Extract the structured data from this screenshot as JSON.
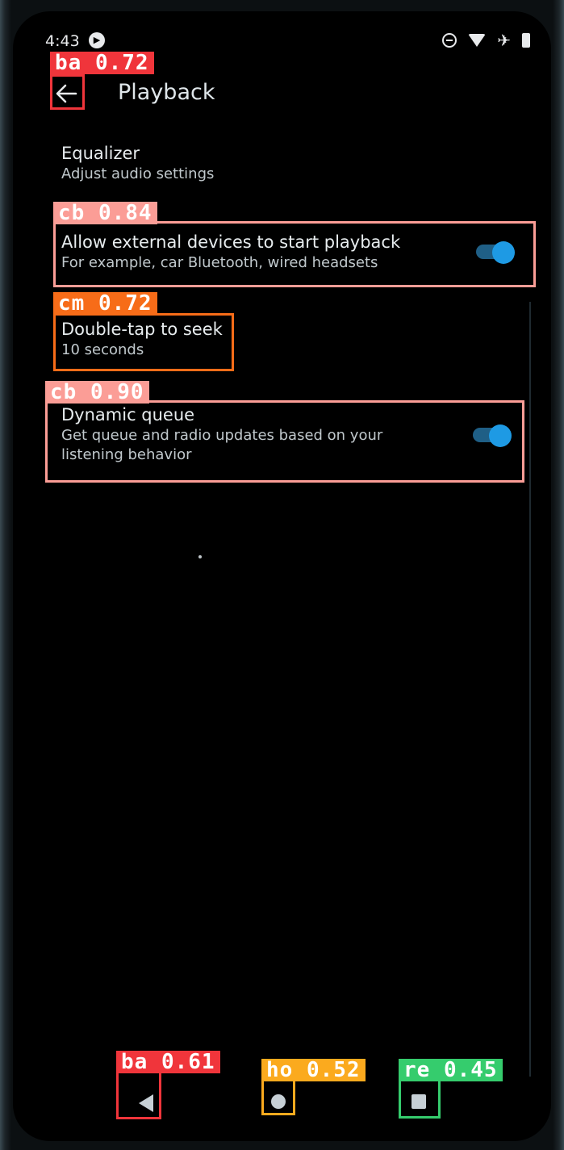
{
  "status_bar": {
    "time": "4:43",
    "icons": [
      "media-playing-icon",
      "do-not-disturb-icon",
      "wifi-icon",
      "airplane-icon",
      "battery-icon"
    ]
  },
  "app_bar": {
    "title": "Playback",
    "back_icon": "arrow-left-icon"
  },
  "settings": [
    {
      "title": "Equalizer",
      "summary": "Adjust audio settings"
    },
    {
      "title": "Allow external devices to start playback",
      "summary": "For example, car Bluetooth, wired headsets",
      "toggle": true
    },
    {
      "title": "Double-tap to seek",
      "summary": "10 seconds"
    },
    {
      "title": "Dynamic queue",
      "summary": "Get queue and radio updates based on your listening behavior",
      "toggle": true
    }
  ],
  "detections": [
    {
      "label": "ba 0.72",
      "color": "#f0353b"
    },
    {
      "label": "cb 0.84",
      "color": "#fb9d96"
    },
    {
      "label": "cm 0.72",
      "color": "#f76c18"
    },
    {
      "label": "cb 0.90",
      "color": "#fb9d96"
    },
    {
      "label": "ba 0.61",
      "color": "#f0353b"
    },
    {
      "label": "ho 0.52",
      "color": "#fbaa1e"
    },
    {
      "label": "re 0.45",
      "color": "#35cc6d"
    }
  ],
  "colors": {
    "accent": "#1e9ae4",
    "background": "#000000"
  },
  "nav_bar": {
    "icons": [
      "nav-back-icon",
      "nav-home-icon",
      "nav-recents-icon"
    ]
  }
}
